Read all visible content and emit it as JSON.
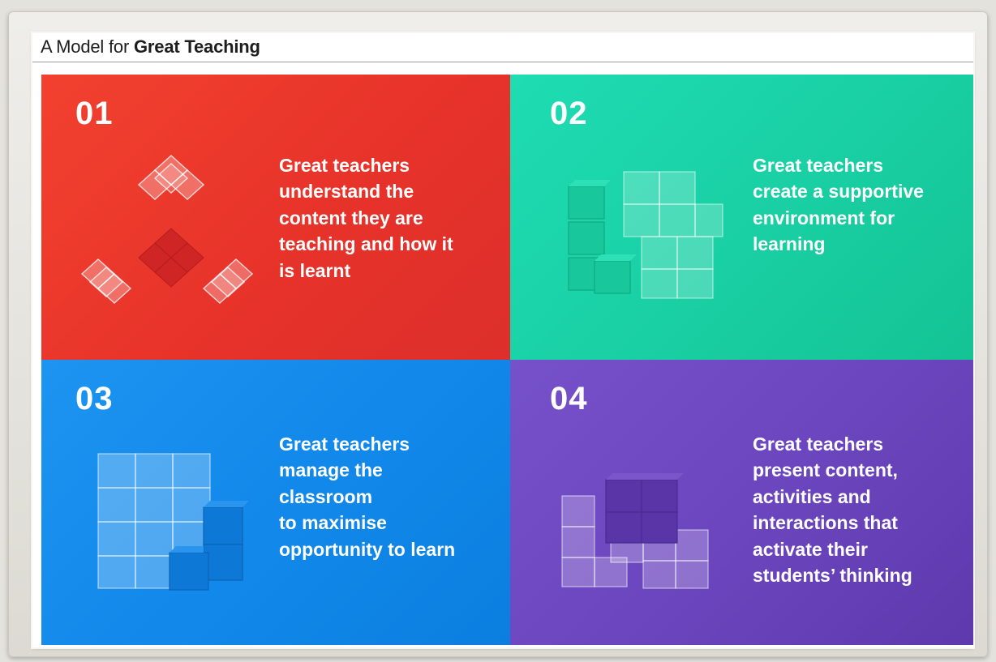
{
  "header": {
    "title_prefix": "A Model for",
    "title_bold": "Great Teaching"
  },
  "quadrants": [
    {
      "number": "01",
      "text": "Great teachers\nunderstand the\ncontent they are\nteaching and how it\nis learnt",
      "color": "#e7332a",
      "illustration": "transparent-and-red-cubes-icon"
    },
    {
      "number": "02",
      "text": "Great teachers\ncreate a supportive\nenvironment for\nlearning",
      "color": "#19cfa3",
      "illustration": "green-cube-stack-icon"
    },
    {
      "number": "03",
      "text": "Great teachers\nmanage the\nclassroom\nto maximise\nopportunity to learn",
      "color": "#1188ea",
      "illustration": "blue-cube-stack-icon"
    },
    {
      "number": "04",
      "text": "Great teachers\npresent content,\nactivities and\ninteractions that\nactivate their\nstudents’ thinking",
      "color": "#6b45bd",
      "illustration": "purple-cube-stack-icon"
    }
  ]
}
